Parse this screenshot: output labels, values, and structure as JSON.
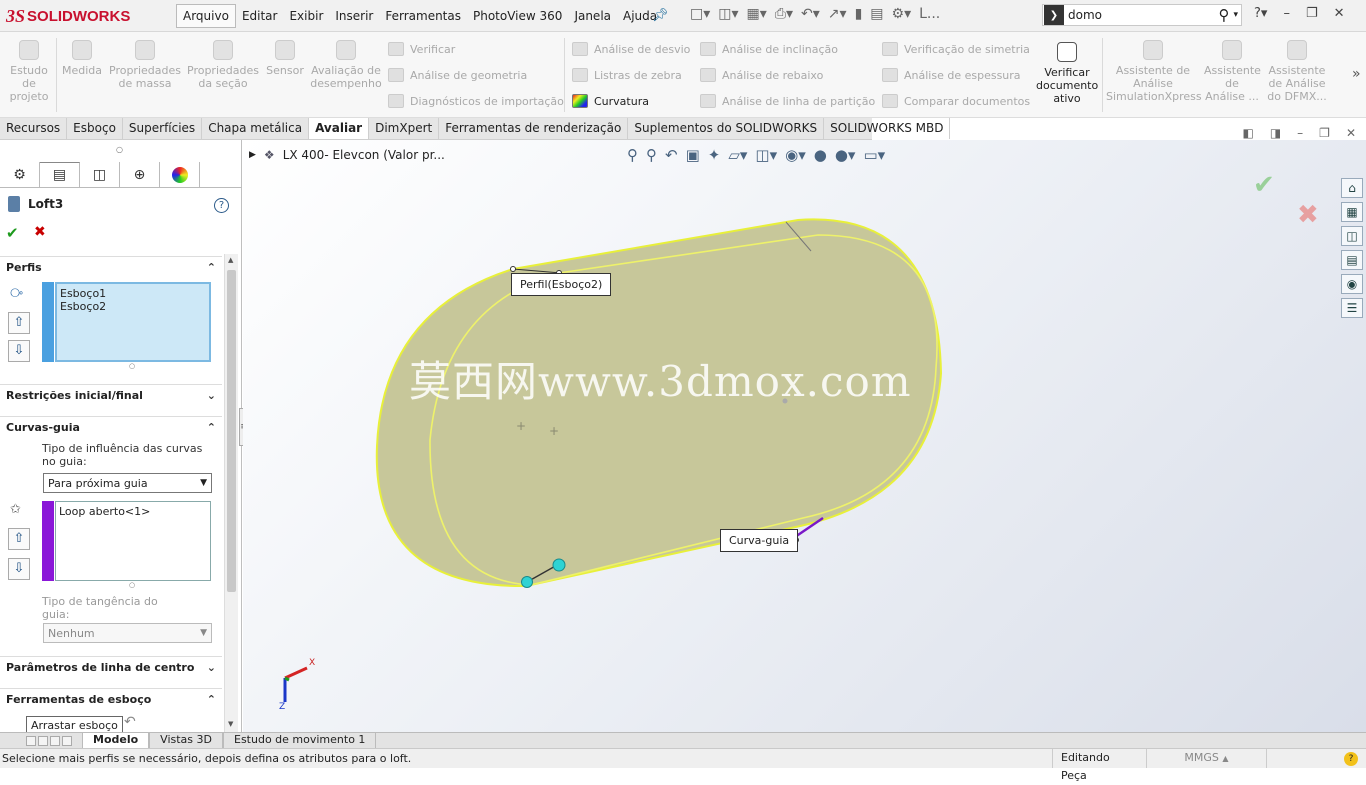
{
  "app": {
    "logo_ds": "3S",
    "logo_text": "SOLIDWORKS"
  },
  "menu": [
    "Arquivo",
    "Editar",
    "Exibir",
    "Inserir",
    "Ferramentas",
    "PhotoView 360",
    "Janela",
    "Ajuda"
  ],
  "quick_access": {
    "truncated_label": "L..."
  },
  "search": {
    "value": "domo"
  },
  "ribbon": {
    "big": [
      {
        "label": "Estudo de projeto"
      },
      {
        "label": "Medida"
      },
      {
        "label": "Propriedades de massa"
      },
      {
        "label": "Propriedades da seção"
      },
      {
        "label": "Sensor"
      },
      {
        "label": "Avaliação de desempenho"
      },
      {
        "label": "Verificar documento ativo"
      },
      {
        "label": "Assistente de Análise SimulationXpress"
      },
      {
        "label": "Assistente de Análise ..."
      },
      {
        "label": "Assistente de Análise do DFMX..."
      }
    ],
    "small": [
      {
        "label": "Verificar"
      },
      {
        "label": "Análise de geometria"
      },
      {
        "label": "Diagnósticos de importação"
      },
      {
        "label": "Análise de desvio"
      },
      {
        "label": "Listras de zebra"
      },
      {
        "label": "Curvatura"
      },
      {
        "label": "Análise de inclinação"
      },
      {
        "label": "Análise de rebaixo"
      },
      {
        "label": "Análise de linha de partição"
      },
      {
        "label": "Verificação de simetria"
      },
      {
        "label": "Análise de espessura"
      },
      {
        "label": "Comparar documentos"
      }
    ]
  },
  "tabs": [
    "Recursos",
    "Esboço",
    "Superfícies",
    "Chapa metálica",
    "Avaliar",
    "DimXpert",
    "Ferramentas de renderização",
    "Suplementos do SOLIDWORKS",
    "SOLIDWORKS MBD"
  ],
  "tabs_active": "Avaliar",
  "feature": {
    "name": "Loft3",
    "help": "?"
  },
  "panel": {
    "perfis": {
      "title": "Perfis",
      "items": [
        "Esboço1",
        "Esboço2"
      ]
    },
    "restricoes": {
      "title": "Restrições inicial/final"
    },
    "curvas_guia": {
      "title": "Curvas-guia",
      "influence_label": "Tipo de influência das curvas no guia:",
      "influence_value": "Para próxima guia",
      "items": [
        "Loop aberto<1>"
      ],
      "tangency_label": "Tipo de tangência do guia:",
      "tangency_value": "Nenhum"
    },
    "centro": {
      "title": "Parâmetros de linha de centro"
    },
    "esboco": {
      "title": "Ferramentas de esboço",
      "drag_button": "Arrastar esboço"
    }
  },
  "viewport": {
    "breadcrumb": "LX 400- Elevcon  (Valor pr...",
    "callout_profile": "Perfil(Esboço2)",
    "callout_guide": "Curva-guia",
    "watermark": "莫西网www.3dmox.com",
    "axis_x": "X",
    "axis_z": "Z"
  },
  "bottom_tabs": [
    "Modelo",
    "Vistas 3D",
    "Estudo de movimento 1"
  ],
  "bottom_tabs_active": "Modelo",
  "status": {
    "message": "Selecione mais perfis se necessário, depois defina os atributos para o loft.",
    "mode": "Editando Peça",
    "units": "MMGS"
  },
  "colors": {
    "brand": "#c8102e",
    "part_fill": "#c7c79a",
    "part_edge": "#e8f03a",
    "guide": "#7a18c8",
    "handle": "#2fd3d3"
  }
}
